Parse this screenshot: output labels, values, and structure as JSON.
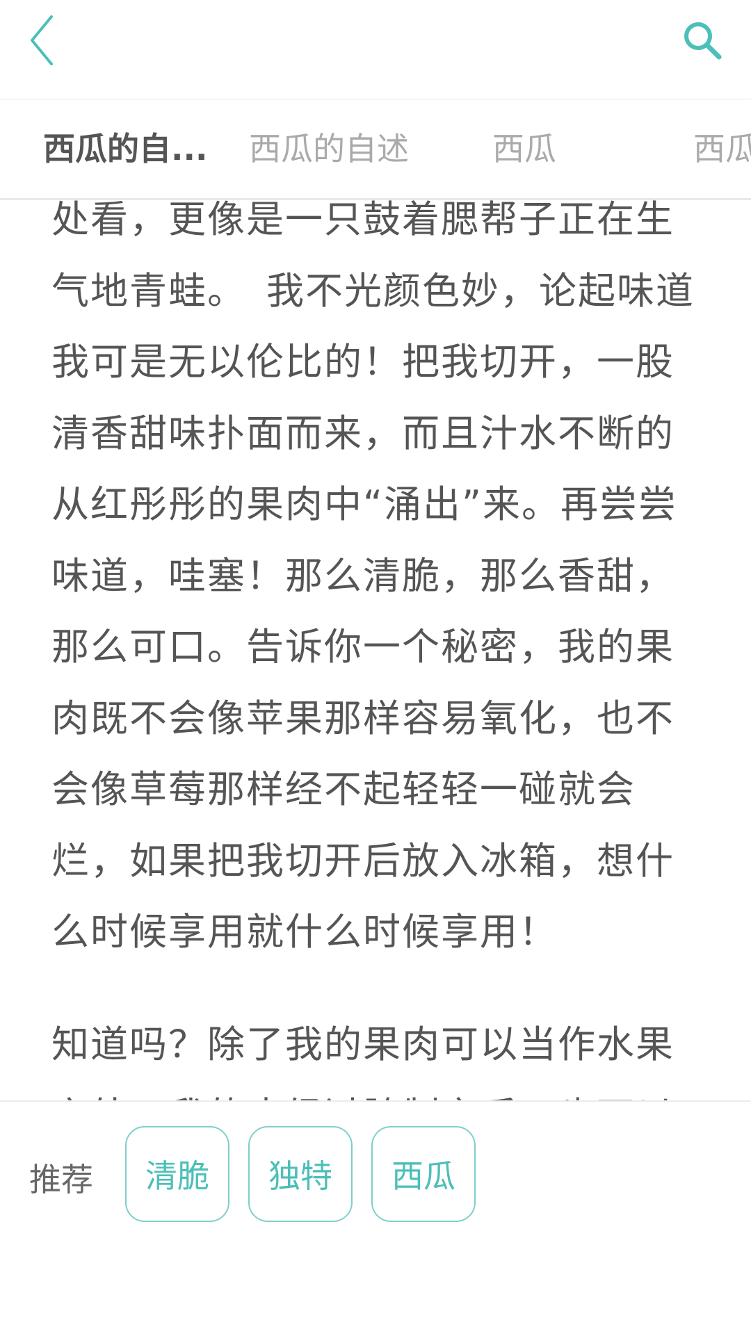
{
  "colors": {
    "accent": "#4bbfb8",
    "text": "#555555",
    "muted": "#aaaaaa"
  },
  "header": {
    "back_icon": "chevron-left-icon",
    "search_icon": "search-icon"
  },
  "tabs": [
    {
      "label": "西瓜的自...",
      "active": true
    },
    {
      "label": "西瓜的自述",
      "active": false
    },
    {
      "label": "西瓜",
      "active": false
    },
    {
      "label": "西瓜",
      "active": false
    }
  ],
  "article": {
    "paragraph_1": "处看，更像是一只鼓着腮帮子正在生气地青蛙。　我不光颜色妙，论起味道我可是无以伦比的！把我切开，一股清香甜味扑面而来，而且汁水不断的从红彤彤的果肉中“涌出”来。再尝尝味道，哇塞！那么清脆，那么香甜，那么可口。告诉你一个秘密，我的果肉既不会像苹果那样容易氧化，也不会像草莓那样经不起轻轻一碰就会烂，如果把我切开后放入冰箱，想什么时候享用就什么时候享用！",
    "paragraph_2": "知道吗？除了我的果肉可以当作水果之外，我的皮经过腌制之后，也可以"
  },
  "recommend": {
    "label": "推荐",
    "tags": [
      "清脆",
      "独特",
      "西瓜"
    ]
  }
}
